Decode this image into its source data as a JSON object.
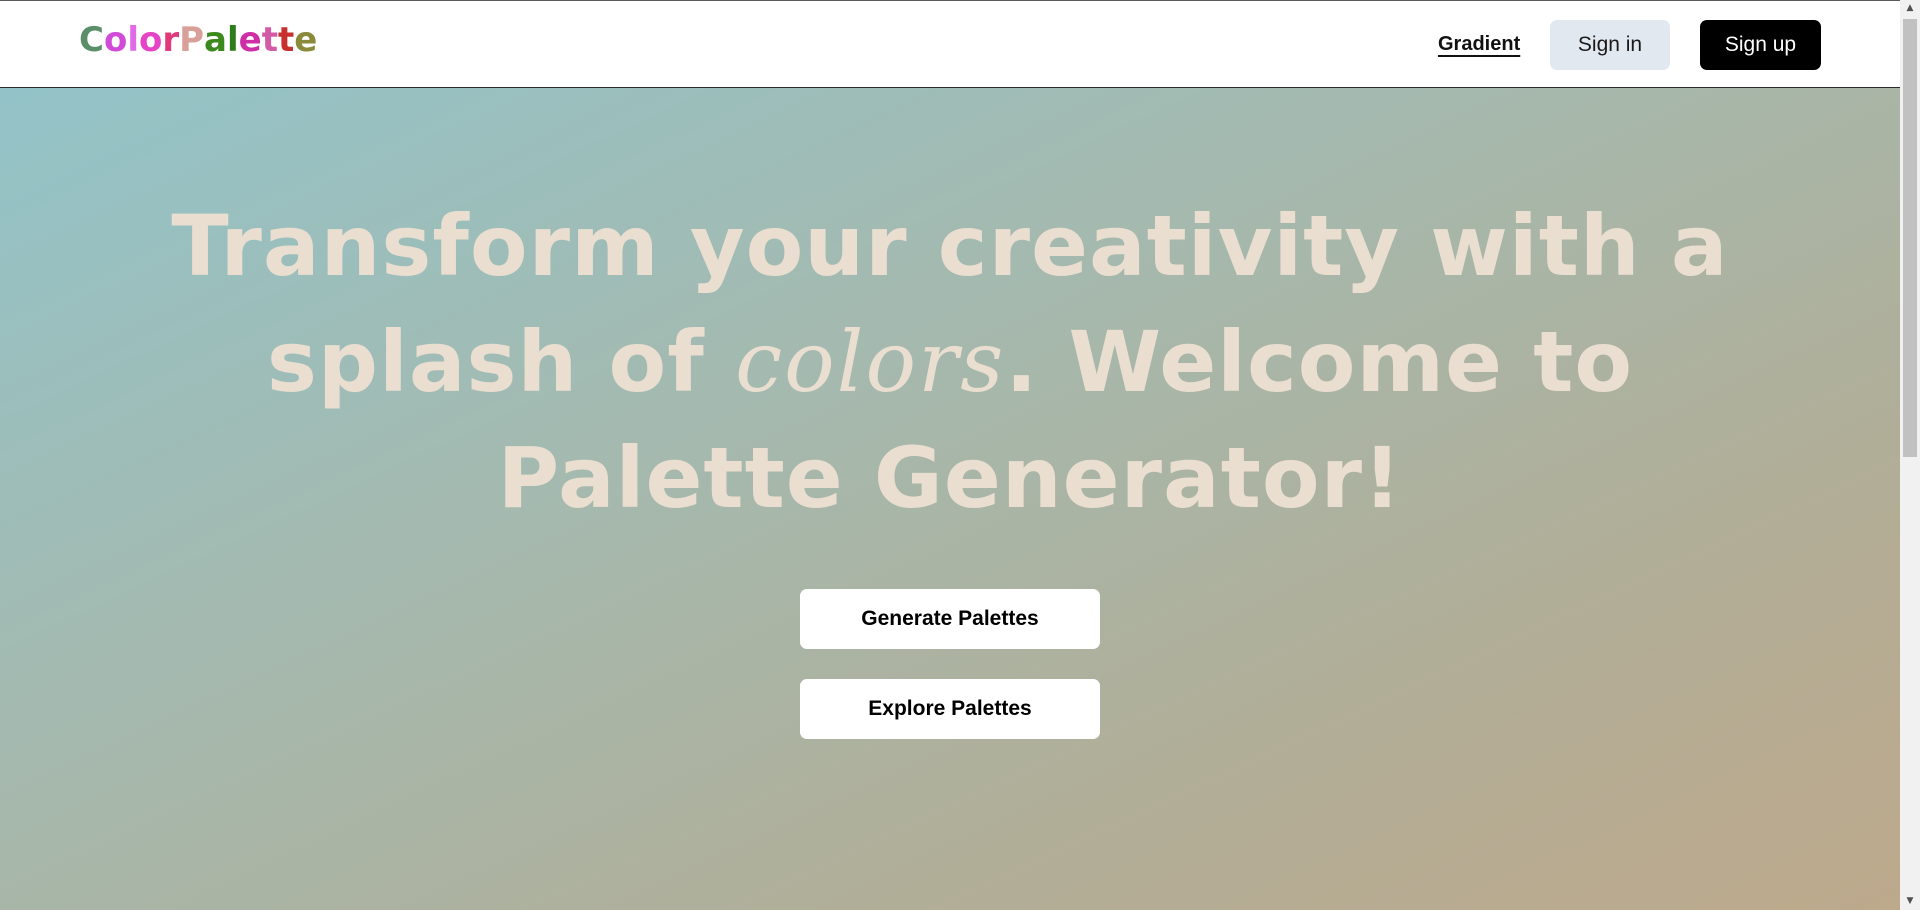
{
  "header": {
    "logo": [
      {
        "char": "C",
        "color": "#5a8f6a"
      },
      {
        "char": "o",
        "color": "#d24ad8"
      },
      {
        "char": "l",
        "color": "#e06be6"
      },
      {
        "char": "o",
        "color": "#e544c7"
      },
      {
        "char": "r",
        "color": "#e03a7a"
      },
      {
        "char": "P",
        "color": "#d8a098"
      },
      {
        "char": "a",
        "color": "#3c8a1e"
      },
      {
        "char": "l",
        "color": "#2f7d1a"
      },
      {
        "char": "e",
        "color": "#cf2fa6"
      },
      {
        "char": "t",
        "color": "#d35aa6"
      },
      {
        "char": "t",
        "color": "#c7302f"
      },
      {
        "char": "e",
        "color": "#8a8a3a"
      }
    ],
    "nav_gradient": "Gradient",
    "signin_label": "Sign in",
    "signup_label": "Sign up"
  },
  "hero": {
    "headline_part1": "Transform your creativity with a splash of ",
    "headline_script": "colors",
    "headline_part2": ". Welcome to Palette Generator!",
    "generate_label": "Generate Palettes",
    "explore_label": "Explore Palettes"
  },
  "scrollbar": {
    "up_icon": "▲",
    "down_icon": "▼"
  }
}
